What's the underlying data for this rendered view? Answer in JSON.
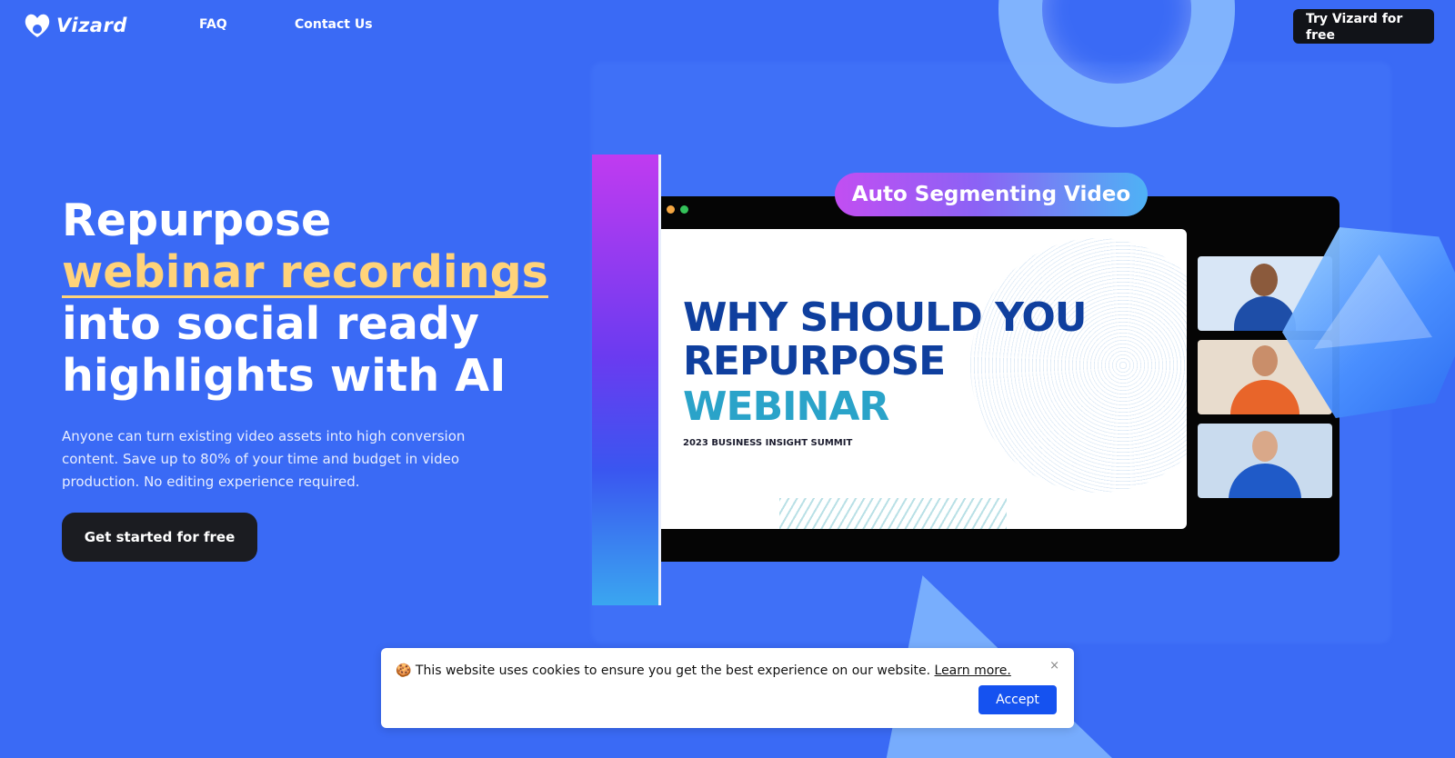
{
  "header": {
    "brand": "Vizard",
    "nav": [
      {
        "label": "FAQ"
      },
      {
        "label": "Contact Us"
      }
    ],
    "cta_label": "Try Vizard for free"
  },
  "hero": {
    "title_line1": "Repurpose",
    "title_highlight": "webinar recordings",
    "title_line3": "into social ready",
    "title_line4": "highlights with AI",
    "description": "Anyone can turn existing video assets into high conversion content. Save up to 80% of your time and budget in video production. No editing experience required.",
    "cta_label": "Get started for free"
  },
  "video_mock": {
    "badge": "Auto Segmenting Video",
    "slide_line1": "WHY SHOULD YOU",
    "slide_line2": "REPURPOSE",
    "slide_line3": "WEBINAR",
    "slide_sub": "2023 BUSINESS INSIGHT SUMMIT"
  },
  "cookie": {
    "emoji": "🍪",
    "text": "This website uses cookies to ensure you get the best experience on our website.",
    "link_label": "Learn more.",
    "close_label": "×",
    "accept_label": "Accept"
  },
  "colors": {
    "background": "#3a6af5",
    "highlight": "#ffd37a",
    "slide_blue": "#0f3f9e",
    "slide_teal": "#2aa3c9",
    "accept": "#1552f0"
  }
}
